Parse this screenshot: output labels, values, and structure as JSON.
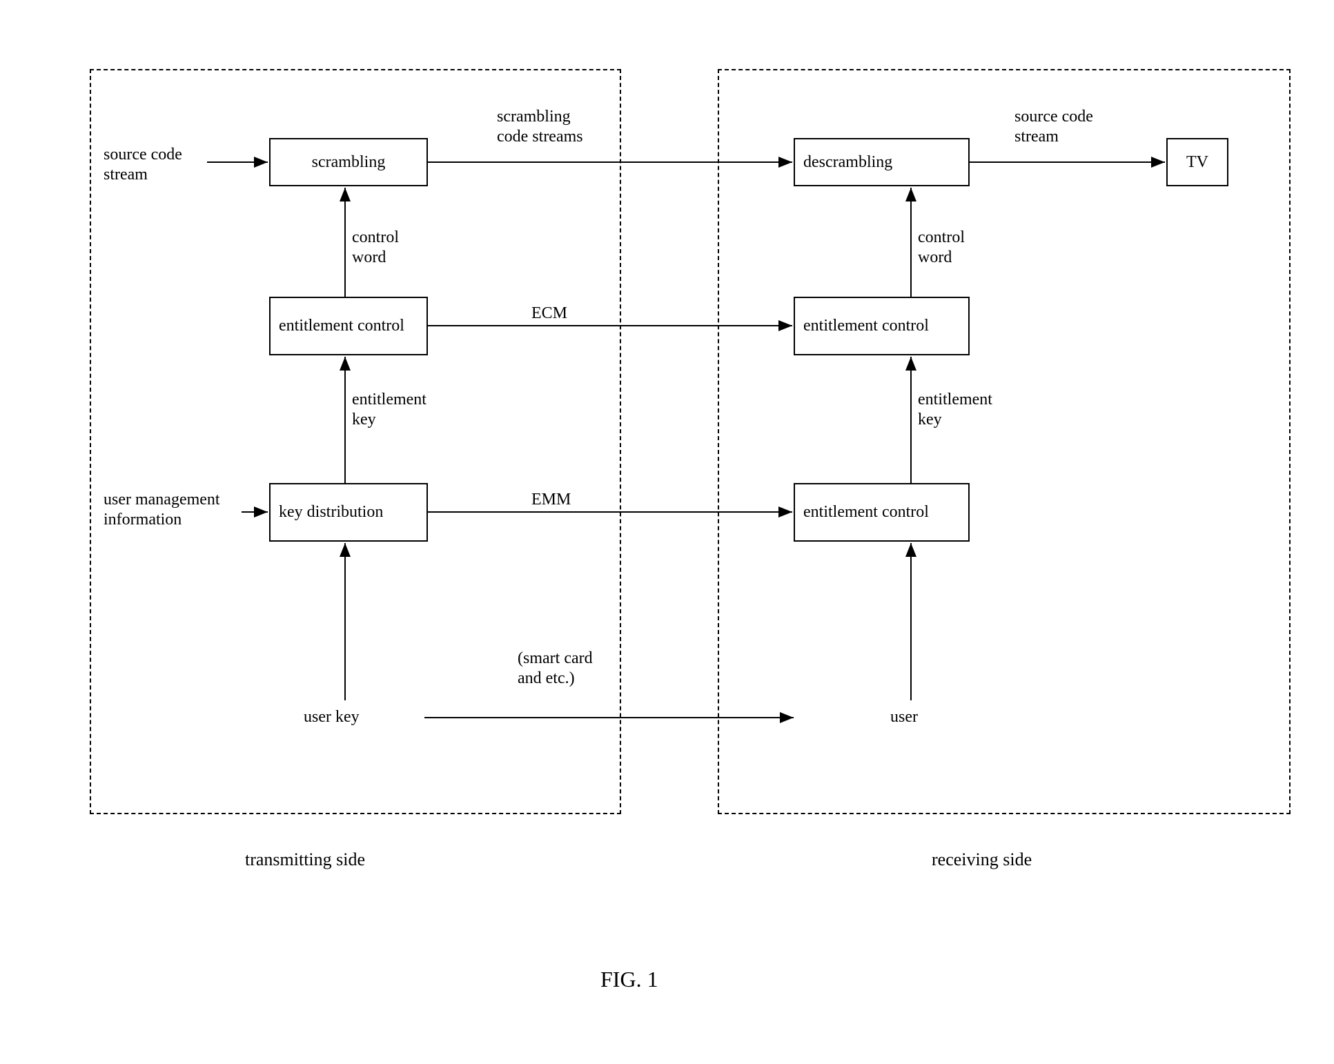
{
  "transmitting": {
    "side_label": "transmitting side",
    "source_code_stream": "source code\nstream",
    "scrambling": "scrambling",
    "control_word": "control\nword",
    "entitlement_control": "entitlement\ncontrol",
    "entitlement_key": "entitlement\nkey",
    "user_mgmt_info": "user management\ninformation",
    "key_distribution": "key\ndistribution",
    "user_key": "user key"
  },
  "middle": {
    "scrambling_code_streams": "scrambling\ncode streams",
    "ecm": "ECM",
    "emm": "EMM",
    "smart_card": "(smart card\nand etc.)"
  },
  "receiving": {
    "side_label": "receiving side",
    "descrambling": "descrambling",
    "source_code_stream": "source code\nstream",
    "tv": "TV",
    "control_word": "control\nword",
    "entitlement_control_1": "entitlement\ncontrol",
    "entitlement_key": "entitlement\nkey",
    "entitlement_control_2": "entitlement\ncontrol",
    "user": "user"
  },
  "figure_label": "FIG. 1"
}
